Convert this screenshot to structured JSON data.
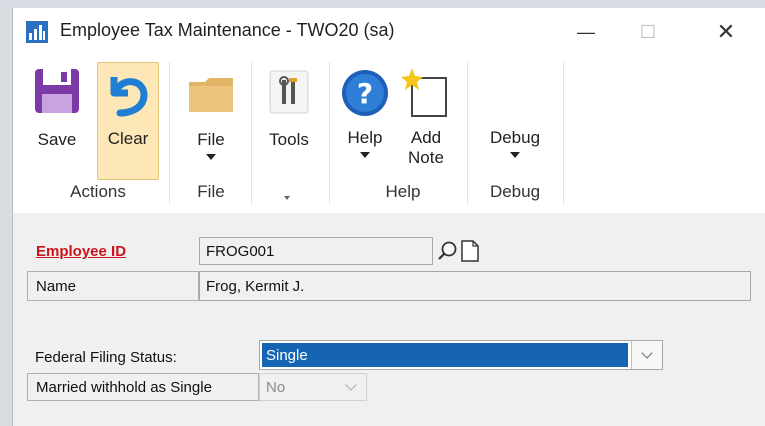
{
  "window": {
    "title": "Employee Tax Maintenance  -  TWO20 (sa)",
    "app_icon": "chart-icon",
    "controls": {
      "minimize": "—",
      "maximize": "☐",
      "close": "✕"
    }
  },
  "ribbon": {
    "actions": {
      "save_label": "Save",
      "clear_label": "Clear",
      "group_label": "Actions"
    },
    "file": {
      "file_label": "File",
      "group_label": "File"
    },
    "tools": {
      "tools_label": "Tools"
    },
    "help": {
      "help_label": "Help",
      "add_note_line1": "Add",
      "add_note_line2": "Note",
      "group_label": "Help"
    },
    "debug": {
      "debug_label": "Debug",
      "group_label": "Debug"
    }
  },
  "form": {
    "employee_id": {
      "label": "Employee ID",
      "value": "FROG001"
    },
    "name": {
      "label": "Name",
      "value": "Frog, Kermit J."
    },
    "federal_filing_status": {
      "label": "Federal Filing Status:",
      "value": "Single"
    },
    "married_withhold": {
      "label": "Married withhold as Single",
      "value": "No"
    }
  },
  "colors": {
    "accent_selected": "#1565b3",
    "required_label": "#c9151b",
    "highlight_button": "#fde7b6"
  }
}
